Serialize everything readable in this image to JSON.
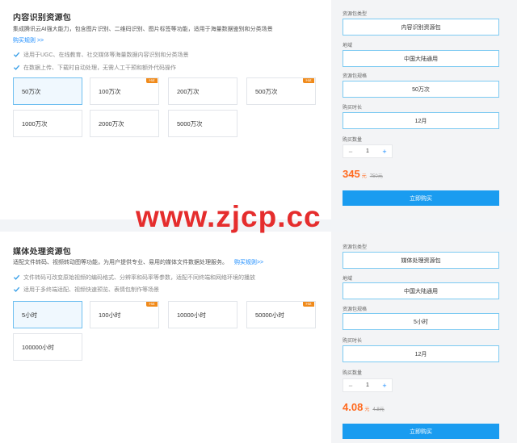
{
  "section1": {
    "title": "内容识别资源包",
    "desc": "集成腾讯云AI强大能力，包含图片识别、二维码识别、图片标签等功能，适用于海量数据鉴别和分类场景",
    "rule_link": "购买规则 >>",
    "features": [
      "适用于UGC、在线教育、社交媒体等海量数据内容识别和分类场景",
      "在数据上传、下载时自动处理，无需人工干预和额外代码操作"
    ],
    "options": [
      {
        "label": "50万次",
        "hot": ""
      },
      {
        "label": "100万次",
        "hot": "Hot"
      },
      {
        "label": "200万次",
        "hot": ""
      },
      {
        "label": "500万次",
        "hot": "Hot"
      },
      {
        "label": "1000万次",
        "hot": ""
      },
      {
        "label": "2000万次",
        "hot": ""
      },
      {
        "label": "5000万次",
        "hot": ""
      }
    ],
    "form": {
      "type_label": "资源包类型",
      "type_value": "内容识别资源包",
      "region_label": "地域",
      "region_value": "中国大陆通用",
      "spec_label": "资源包规格",
      "spec_value": "50万次",
      "duration_label": "购买时长",
      "duration_value": "12月",
      "qty_label": "购买数量",
      "qty_value": "1",
      "minus": "−",
      "plus": "+",
      "price": "345",
      "price_unit": "元",
      "orig_price": "750元",
      "buy": "立即购买"
    }
  },
  "section2": {
    "title": "媒体处理资源包",
    "desc": "适配文件转码、视频转动图等功能，为用户提供专业、易用的媒体文件数据处理服务。",
    "rule_link": "购买规则>>",
    "features": [
      "文件转码可改变原始视频的编码格式、分辨率和码率等参数，适配不同终端和网络环境的播放",
      "适用于多终端适配、视频快速预览、表情包制作等场景"
    ],
    "options": [
      {
        "label": "5小时",
        "hot": ""
      },
      {
        "label": "100小时",
        "hot": "Hot"
      },
      {
        "label": "10000小时",
        "hot": ""
      },
      {
        "label": "50000小时",
        "hot": "Hot"
      },
      {
        "label": "100000小时",
        "hot": ""
      }
    ],
    "form": {
      "type_label": "资源包类型",
      "type_value": "媒体处理资源包",
      "region_label": "地域",
      "region_value": "中国大陆通用",
      "spec_label": "资源包规格",
      "spec_value": "5小时",
      "duration_label": "购买时长",
      "duration_value": "12月",
      "qty_label": "购买数量",
      "qty_value": "1",
      "minus": "−",
      "plus": "+",
      "price": "4.08",
      "price_unit": "元",
      "orig_price": "4.8元",
      "buy": "立即购买"
    }
  },
  "watermark": "www.zjcp.cc",
  "colors": {
    "accent": "#1a9cf0",
    "price": "#ff6a1f",
    "hot": "#f08a1a",
    "watermark": "#e52d2d",
    "check": "#3aa0e8"
  }
}
